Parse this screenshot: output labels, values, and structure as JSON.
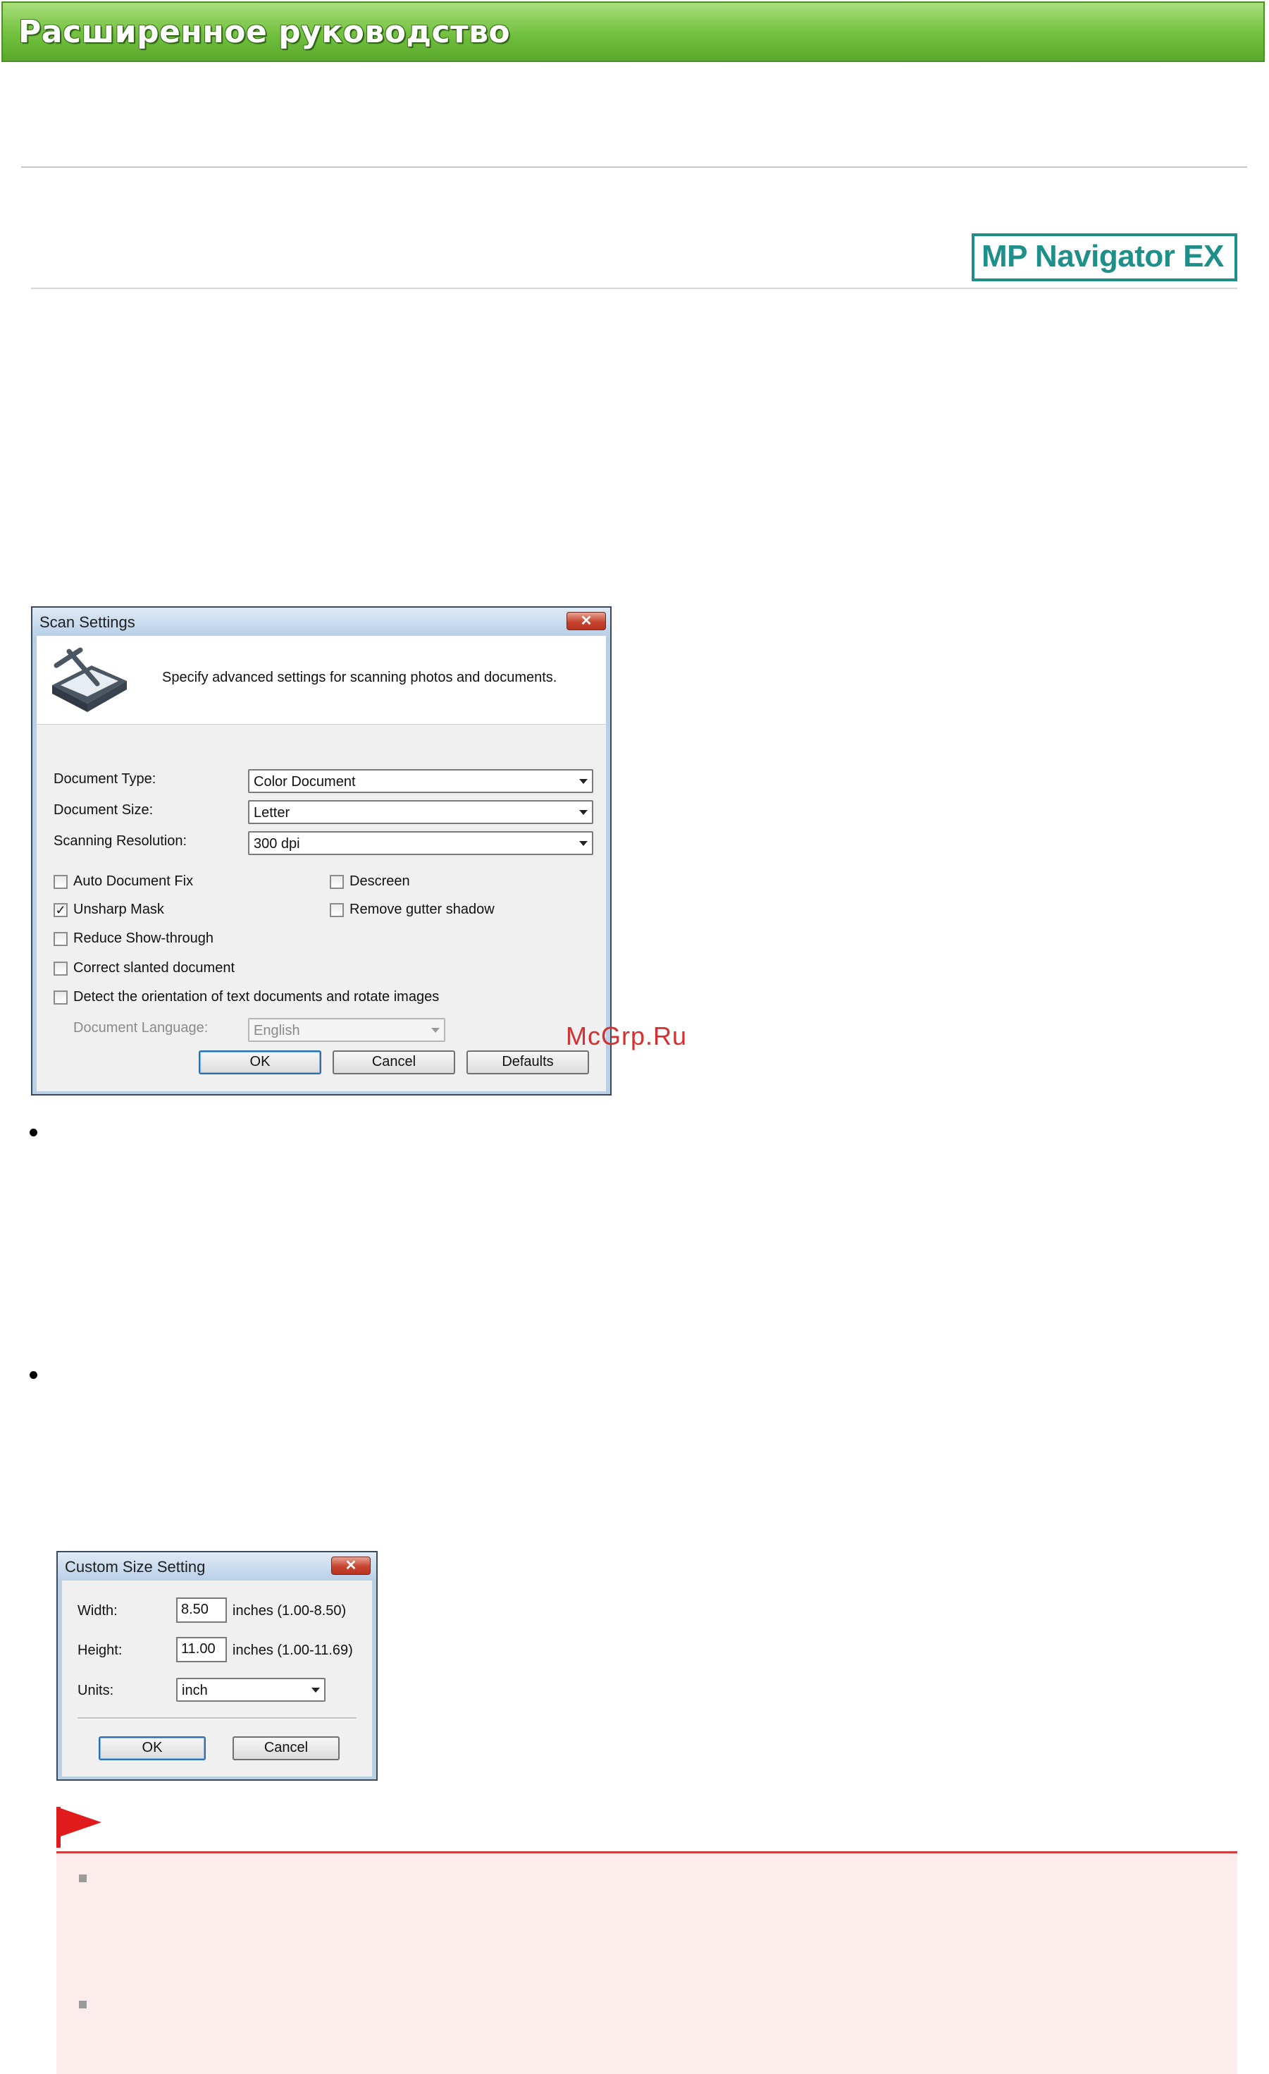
{
  "header": {
    "title": "Расширенное руководство"
  },
  "logo": {
    "text": "MP Navigator EX"
  },
  "watermark": "McGrp.Ru",
  "scan_settings": {
    "title": "Scan Settings",
    "close_glyph": "✕",
    "description": "Specify advanced settings for scanning photos and documents.",
    "fields": [
      {
        "label": "Document Type:",
        "value": "Color Document"
      },
      {
        "label": "Document Size:",
        "value": "Letter"
      },
      {
        "label": "Scanning Resolution:",
        "value": "300 dpi"
      }
    ],
    "checkboxes": [
      {
        "label": "Auto Document Fix",
        "checked": false
      },
      {
        "label": "Unsharp Mask",
        "checked": true
      },
      {
        "label": "Reduce Show-through",
        "checked": false
      },
      {
        "label": "Correct slanted document",
        "checked": false
      },
      {
        "label": "Detect the orientation of text documents and rotate images",
        "checked": false
      },
      {
        "label": "Descreen",
        "checked": false
      },
      {
        "label": "Remove gutter shadow",
        "checked": false
      }
    ],
    "language": {
      "label": "Document Language:",
      "value": "English"
    },
    "buttons": {
      "ok": "OK",
      "cancel": "Cancel",
      "defaults": "Defaults"
    }
  },
  "custom_size": {
    "title": "Custom Size Setting",
    "close_glyph": "✕",
    "width": {
      "label": "Width:",
      "value": "8.50",
      "range": "inches (1.00-8.50)"
    },
    "height": {
      "label": "Height:",
      "value": "11.00",
      "range": "inches (1.00-11.69)"
    },
    "units": {
      "label": "Units:",
      "value": "inch"
    },
    "buttons": {
      "ok": "OK",
      "cancel": "Cancel"
    }
  },
  "colors": {
    "banner_green": "#72c03f",
    "logo_teal": "#1f8f8a",
    "note_red": "#d23c3c",
    "note_bg": "#fdecec"
  }
}
